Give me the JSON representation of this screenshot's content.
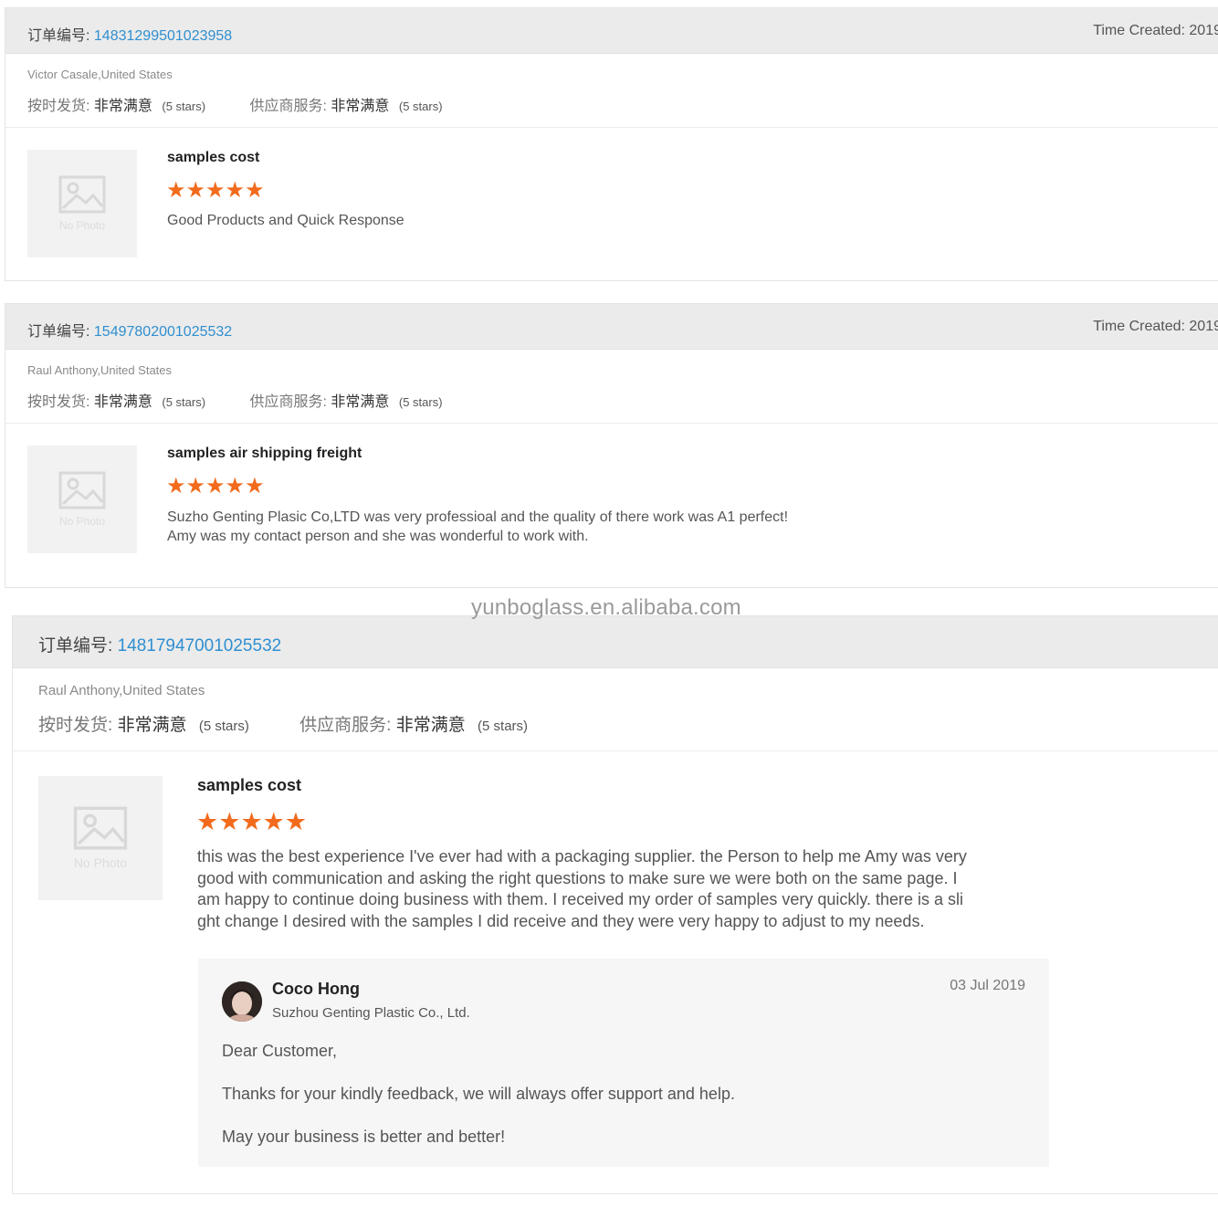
{
  "watermark": "yunboglass.en.alibaba.com",
  "labels": {
    "order_prefix": "订单编号: ",
    "time_created": "Time Created: 2019",
    "ontime": "按时发货: ",
    "supplier_service": "供应商服务: ",
    "satisfaction": "非常满意",
    "stars_text": "(5 stars)",
    "no_photo": "No Photo"
  },
  "reviews": [
    {
      "order_number": "14831299501023958",
      "buyer": "Victor Casale,United States",
      "ontime_rating": 5,
      "supplier_rating": 5,
      "product_title": "samples cost",
      "product_stars": 5,
      "review_text": "Good Products and Quick Response"
    },
    {
      "order_number": "15497802001025532",
      "buyer": "Raul Anthony,United States",
      "ontime_rating": 5,
      "supplier_rating": 5,
      "product_title": "samples air shipping freight",
      "product_stars": 5,
      "review_text_lines": [
        "Suzho Genting Plasic Co,LTD was very professioal and the quality of there work was A1 perfect!",
        "Amy was my contact person and she was wonderful to work with."
      ]
    },
    {
      "order_number": "14817947001025532",
      "buyer": "Raul Anthony,United States",
      "ontime_rating": 5,
      "supplier_rating": 5,
      "product_title": "samples cost",
      "product_stars": 5,
      "review_text_lines": [
        "this was the best experience I've ever had with a packaging supplier.  the Person to help me Amy was very",
        "good with communication and asking the right questions to make sure we were both on the same page. I",
        "am happy to continue doing business with them. I received my order of samples very quickly. there is a sli",
        "ght change I desired with the samples I did receive and they were very happy to adjust to my needs."
      ],
      "reply": {
        "name": "Coco Hong",
        "company": "Suzhou Genting Plastic Co., Ltd.",
        "date": "03 Jul 2019",
        "lines": [
          "Dear Customer,",
          "Thanks for your kindly feedback, we will always offer support and help.",
          "May your business is better and better!"
        ]
      }
    }
  ],
  "colors": {
    "order_number": "#2f8fd0",
    "star": "#f26b1d",
    "header_bg": "#ebebeb"
  },
  "icons": [
    "image-placeholder-icon",
    "star-icon",
    "avatar"
  ]
}
